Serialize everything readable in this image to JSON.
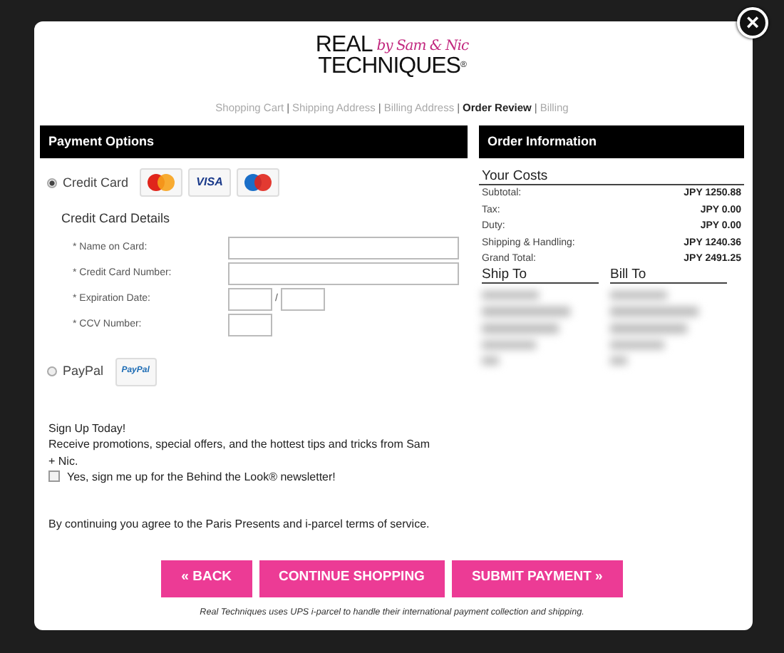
{
  "logo": {
    "line1": "REAL",
    "line2": "TECHNIQUES",
    "mark": "®",
    "tagline": "by Sam & Nic"
  },
  "close": {
    "symbol": "×"
  },
  "steps": [
    {
      "label": "Shopping Cart",
      "selected": false
    },
    {
      "label": "Shipping Address",
      "selected": false
    },
    {
      "label": "Billing Address",
      "selected": false
    },
    {
      "label": "Order Review",
      "selected": true
    },
    {
      "label": "Billing",
      "selected": false
    }
  ],
  "step_separator": "|",
  "payment": {
    "title": "Payment Options",
    "methods": [
      {
        "label": "Credit Card",
        "selected": true,
        "cards": [
          {
            "kind": "mastercard"
          },
          {
            "kind": "visa",
            "text": "VISA"
          },
          {
            "kind": "maestro"
          }
        ]
      },
      {
        "label": "PayPal",
        "selected": false,
        "cards": [
          {
            "kind": "paypal",
            "text": "PayPal"
          }
        ]
      }
    ],
    "details_title": "Credit Card Details",
    "fields": [
      {
        "label": "* Name on Card:",
        "kind": "wide"
      },
      {
        "label": "* Credit Card Number:",
        "kind": "wide"
      },
      {
        "label": "* Expiration Date:",
        "kind": "expiry",
        "separator": "/"
      },
      {
        "label": "* CCV Number:",
        "kind": "short"
      }
    ]
  },
  "signup": {
    "heading": "Sign Up Today!",
    "text": "Receive promotions, special offers, and the hottest tips and tricks from Sam + Nic.",
    "checkbox": {
      "label": "Yes, sign me up for the Behind the Look® newsletter!",
      "checked": false
    }
  },
  "terms": "By continuing you agree to the Paris Presents and i-parcel terms of service.",
  "order": {
    "title": "Order Information",
    "costs_title": "Your Costs",
    "costs": [
      {
        "label": "Subtotal:",
        "value": "JPY 1250.88"
      },
      {
        "label": "Tax:",
        "value": "JPY 0.00"
      },
      {
        "label": "Duty:",
        "value": "JPY 0.00"
      },
      {
        "label": "Shipping & Handling:",
        "value": "JPY 1240.36"
      },
      {
        "label": "Grand Total:",
        "value": "JPY 2491.25"
      }
    ],
    "addresses": [
      {
        "title": "Ship To"
      },
      {
        "title": "Bill To"
      }
    ]
  },
  "buttons": [
    {
      "label": "« BACK"
    },
    {
      "label": "CONTINUE SHOPPING"
    },
    {
      "label": "SUBMIT PAYMENT »"
    }
  ],
  "footnote": "Real Techniques uses UPS i-parcel to handle their international payment collection and shipping."
}
